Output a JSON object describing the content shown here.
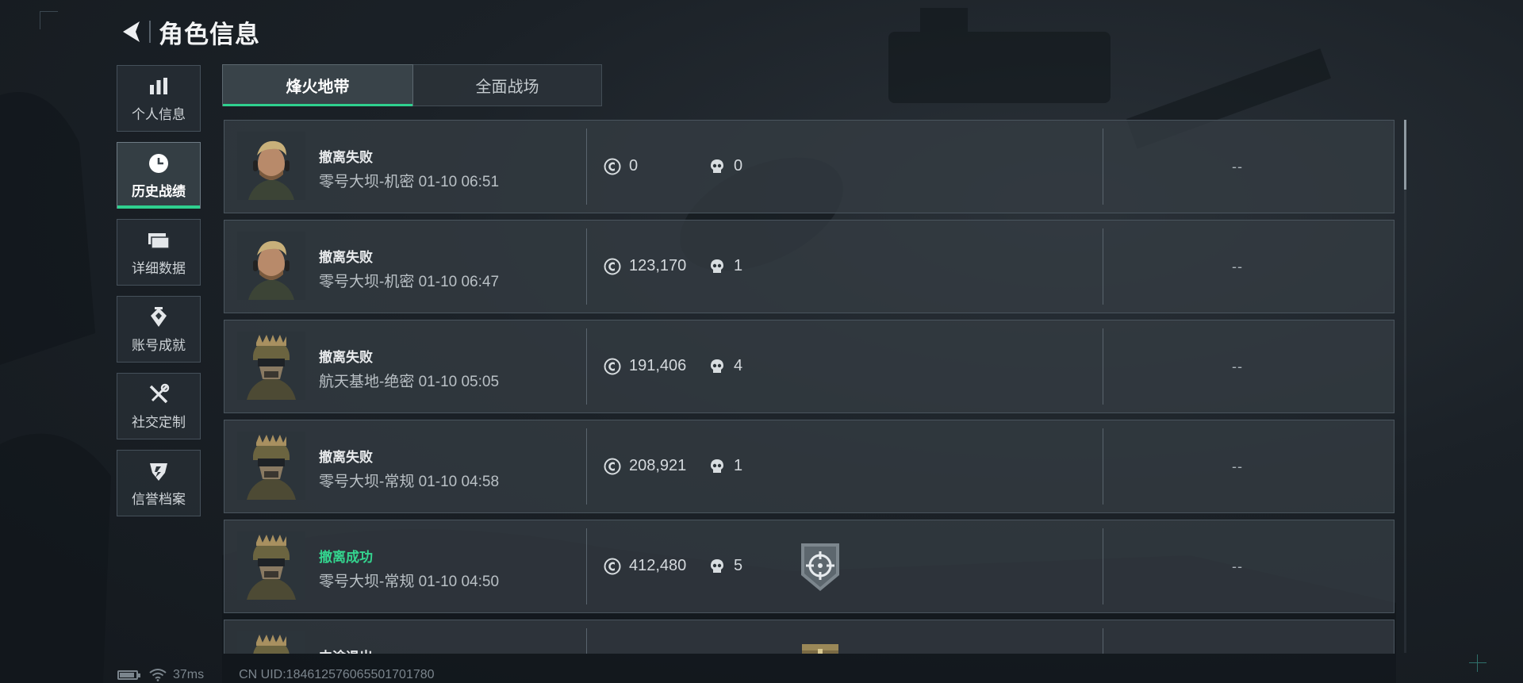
{
  "header": {
    "title": "角色信息"
  },
  "sidebar": {
    "items": [
      {
        "label": "个人信息",
        "icon": "bar-chart-icon",
        "active": false
      },
      {
        "label": "历史战绩",
        "icon": "clock-icon",
        "active": true
      },
      {
        "label": "详细数据",
        "icon": "cards-icon",
        "active": false
      },
      {
        "label": "账号成就",
        "icon": "medal-icon",
        "active": false
      },
      {
        "label": "社交定制",
        "icon": "tools-icon",
        "active": false
      },
      {
        "label": "信誉档案",
        "icon": "shield-emblem-icon",
        "active": false
      }
    ]
  },
  "tabs": [
    {
      "label": "烽火地带",
      "active": true
    },
    {
      "label": "全面战场",
      "active": false
    }
  ],
  "matches": [
    {
      "status": "撤离失败",
      "status_type": "fail",
      "map": "零号大坝-机密 01-10 06:51",
      "value": "0",
      "kills": "0",
      "badge": "",
      "extra": "--",
      "avatar": "operator-a"
    },
    {
      "status": "撤离失败",
      "status_type": "fail",
      "map": "零号大坝-机密 01-10 06:47",
      "value": "123,170",
      "kills": "1",
      "badge": "",
      "extra": "--",
      "avatar": "operator-a"
    },
    {
      "status": "撤离失败",
      "status_type": "fail",
      "map": "航天基地-绝密 01-10 05:05",
      "value": "191,406",
      "kills": "4",
      "badge": "",
      "extra": "--",
      "avatar": "operator-b"
    },
    {
      "status": "撤离失败",
      "status_type": "fail",
      "map": "零号大坝-常规 01-10 04:58",
      "value": "208,921",
      "kills": "1",
      "badge": "",
      "extra": "--",
      "avatar": "operator-b"
    },
    {
      "status": "撤离成功",
      "status_type": "success",
      "map": "零号大坝-常规 01-10 04:50",
      "value": "412,480",
      "kills": "5",
      "badge": "crosshair-shield-badge",
      "extra": "--",
      "avatar": "operator-b"
    },
    {
      "status": "中途退出",
      "status_type": "fail",
      "map": "",
      "value": "",
      "kills": "",
      "badge": "chest-badge",
      "extra": "",
      "avatar": "operator-b"
    }
  ],
  "footer": {
    "battery_level": 0.8,
    "ping": "37ms",
    "uid": "CN UID:1846125760655017017​80"
  },
  "colors": {
    "accent": "#2fd08f",
    "success": "#34d58f"
  }
}
